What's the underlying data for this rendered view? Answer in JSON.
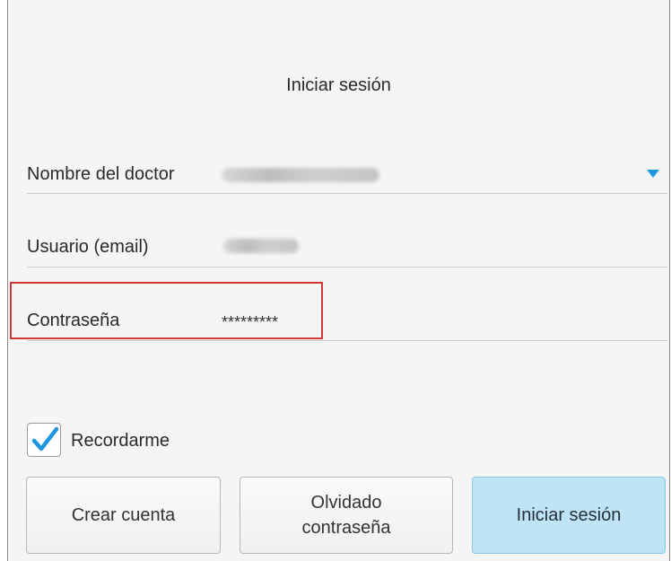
{
  "title": "Iniciar sesión",
  "fields": {
    "doctor": {
      "label": "Nombre del doctor",
      "value": ""
    },
    "email": {
      "label": "Usuario (email)",
      "value": ""
    },
    "password": {
      "label": "Contraseña",
      "value": "*********"
    }
  },
  "remember": {
    "label": "Recordarme",
    "checked": true
  },
  "buttons": {
    "create": "Crear cuenta",
    "forgot_line1": "Olvidado",
    "forgot_line2": "contraseña",
    "login": "Iniciar sesión"
  },
  "colors": {
    "accent": "#1e96e0",
    "highlight": "#d0383a",
    "primary_button": "#bfe4f6"
  }
}
